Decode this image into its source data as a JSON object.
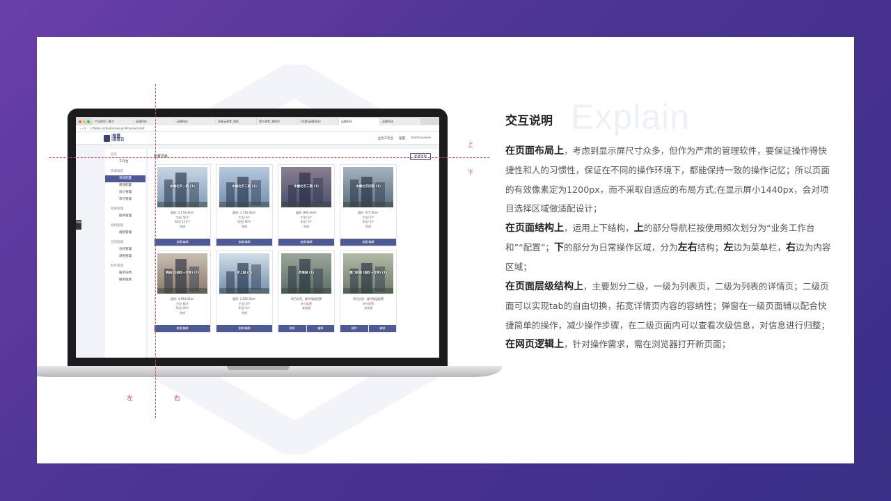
{
  "browser": {
    "tabs": [
      "产品原型 | 墨刀",
      "英模科技",
      "英模科技",
      "网易云课堂_我的",
      "悉尔课堂_我的资",
      "1号楼(英模科技)",
      "英模科技",
      "英模科技"
    ],
    "url": "s.fhelia.cn/build-saas-pc/#resource/list"
  },
  "app": {
    "logo_line1": "|智慧",
    "logo_line2": "|运营云",
    "header_workbench": "业务工作台",
    "header_config": "配置",
    "header_user": "moohuanwei",
    "sidebar": {
      "home": "首页",
      "workbench": "工作台",
      "group_resource": "资源规划",
      "project_config": "项目配置",
      "fee_config": "费项配置",
      "price_manage": "造价管理",
      "unit_manage": "单元管理",
      "group_leasing": "招商管理",
      "lease_manage": "招商管理",
      "group_planning": "规划管理",
      "plan_manage": "规划管理",
      "group_contract": "合同管理",
      "contract_manage": "合同管理",
      "return_manage": "退租管理",
      "group_finance": "财务管理",
      "bill_archive": "账单归档",
      "bill_collect": "账单收款",
      "tag": "收起"
    },
    "content_title": "配置项目",
    "new_button": "新建项目",
    "projects": [
      {
        "name": "水墨北平一期 (1)",
        "l1": "面积: 3,178.00m²",
        "l2": "工位/ 56个",
        "l3": "车位/ 115个",
        "status": "完成",
        "status_type": "ok",
        "btn1": "查看/编辑",
        "btn2": ""
      },
      {
        "name": "水墨北平二期 (1)",
        "l1": "面积: 3,736.00m²",
        "l2": "工位/ 0个",
        "l3": "车位/ 60个",
        "status": "完成",
        "status_type": "ok",
        "btn1": "查看/编辑",
        "btn2": ""
      },
      {
        "name": "水墨北平三期 (1)",
        "l1": "面积: 890.00m²",
        "l2": "工位/ 0个",
        "l3": "车位/ 0个",
        "status": "完成",
        "status_type": "ok",
        "btn1": "查看/编辑",
        "btn2": ""
      },
      {
        "name": "水墨北平四期 (1)",
        "l1": "面积: 375.00m²",
        "l2": "工位/ 0个",
        "l3": "车位/ 0个",
        "status": "完成",
        "status_type": "ok",
        "btn1": "查看/编辑",
        "btn2": ""
      },
      {
        "name": "晓园公(园区+仓库) (2)",
        "l1": "面积: 4,954.00m²",
        "l2": "工位/ 60个",
        "l3": "车位/ 20个",
        "status": "完成",
        "status_type": "ok",
        "btn1": "查看/编辑",
        "btn2": ""
      },
      {
        "name": "学上园 (0)",
        "l1": "面积: 2,095.00m²",
        "l2": "工位/ 0个",
        "l3": "车位/ 0个",
        "status": "完成",
        "status_type": "ok",
        "btn1": "查看/编辑",
        "btn2": ""
      },
      {
        "name": "西城园 (1)",
        "l1": "项目信息、楼宇楼层配置",
        "l2": "单元配置",
        "l3": "未完成",
        "status": "",
        "status_type": "warn",
        "btn1": "删除",
        "btn2": "编辑"
      },
      {
        "name": "厦门前期 (园区+仓库) (1)",
        "l1": "项目信息、楼宇楼层配置",
        "l2": "单元配置",
        "l3": "未完成",
        "status": "",
        "status_type": "warn",
        "btn1": "删除",
        "btn2": "编辑"
      }
    ]
  },
  "guides": {
    "top": "上",
    "bottom": "下",
    "left": "左",
    "right": "右"
  },
  "explain": {
    "bg_word": "Explain",
    "title": "交互说明",
    "p1_head": "在页面布局上",
    "p1_body": "，考虑到显示屏尺寸众多，但作为严肃的管理软件，要保证操作得快捷性和人的习惯性，保证在不同的操作环境下，都能保持一致的操作记忆；所以页面的有效像素定为1200px，而不采取自适应的布局方式;在显示屏小1440px，会对项目选择区域做适配设计；",
    "p2_head": "在页面结构上",
    "p2_body_a": "，运用上下结构，",
    "p2_up": "上",
    "p2_body_b": "的部分导航栏按使用频次划分为“业务工作台和”“配置”；",
    "p2_down": "下",
    "p2_body_c": "的部分为日常操作区域，分为",
    "p2_lr": "左右",
    "p2_body_d": "结构；",
    "p2_left": "左",
    "p2_body_e": "边为菜单栏，",
    "p2_right": "右",
    "p2_body_f": "边为内容区域；",
    "p3_head": "在页面层级结构上",
    "p3_body": "，主要划分二级，一级为列表页，二级为列表的详情页；二级页面可以实现tab的自由切换，拓宽详情页内容的容纳性；弹窗在一级页面辅以配合快捷简单的操作，减少操作步骤，在二级页面内可以查看次级信息，对信息进行归整；",
    "p4_head": "在网页逻辑上",
    "p4_body": "，针对操作需求，需在浏览器打开新页面；"
  },
  "colors": {
    "accent": "#4e5a96",
    "guide": "#e04a5f",
    "bg_start": "#6b3fa8",
    "bg_end": "#3a2f86"
  }
}
